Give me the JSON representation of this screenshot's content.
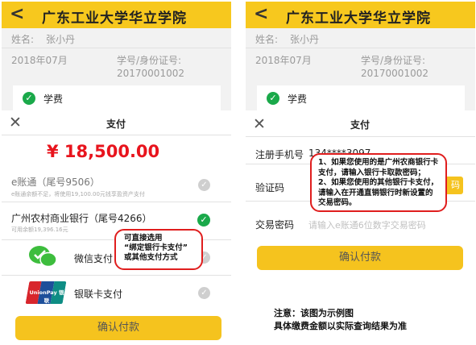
{
  "school_title": "广东工业大学华立学院",
  "back_icon": "<",
  "left": {
    "name_label": "姓名:",
    "name_value": "张小丹",
    "fee_item": "学费",
    "sheet_title": "支付",
    "amount": "¥ 18,500.00",
    "methods": [
      {
        "name": "e账通（尾号9506）",
        "sub": "e账通余额不足，将使用19,100.00元钱享盈资产支付",
        "state": "disabled"
      },
      {
        "name": "广州农村商业银行（尾号4266）",
        "sub": "可用余额19,396.16元",
        "state": "selected"
      },
      {
        "name": "微信支付",
        "sub": "",
        "state": "disabled"
      },
      {
        "name": "银联卡支付",
        "sub": "",
        "state": "disabled"
      }
    ],
    "unionpay_logo_text": "UnionPay 银联",
    "callout": [
      "可直接选用",
      "“绑定银行卡支付”",
      "或其他支付方式"
    ],
    "confirm": "确认付款"
  },
  "right": {
    "name_label": "姓名:",
    "name_value": "张小丹",
    "date": "2018年07月",
    "id_label": "学号/身份证号:",
    "id_value": "20170001002",
    "fee_item": "学费",
    "sheet_title": "支付",
    "phone_label": "注册手机号",
    "phone_value": "134****3097",
    "code_label": "验证码",
    "code_button": "码",
    "password_label": "交易密码",
    "password_placeholder": "请输入e账通6位数字交易密码",
    "callout": [
      "1、如果您使用的是广州农商银行卡",
      "支付，请输入银行卡取款密码；",
      "2、如果您使用的其他银行卡支付，",
      "请输入在开通直销银行时新设置的",
      "交易密码。"
    ],
    "confirm": "确认付款"
  },
  "left_date": "2018年07月",
  "left_id_label": "学号/身份证号:",
  "left_id_value": "20170001002",
  "note": [
    "注意：该图为示例图",
    "具体缴费金额以实际查询结果为准"
  ],
  "colors": {
    "header": "#f7c81e",
    "amount": "#e8141d",
    "selected": "#1aa94a",
    "callout_border": "#e01e1e"
  }
}
